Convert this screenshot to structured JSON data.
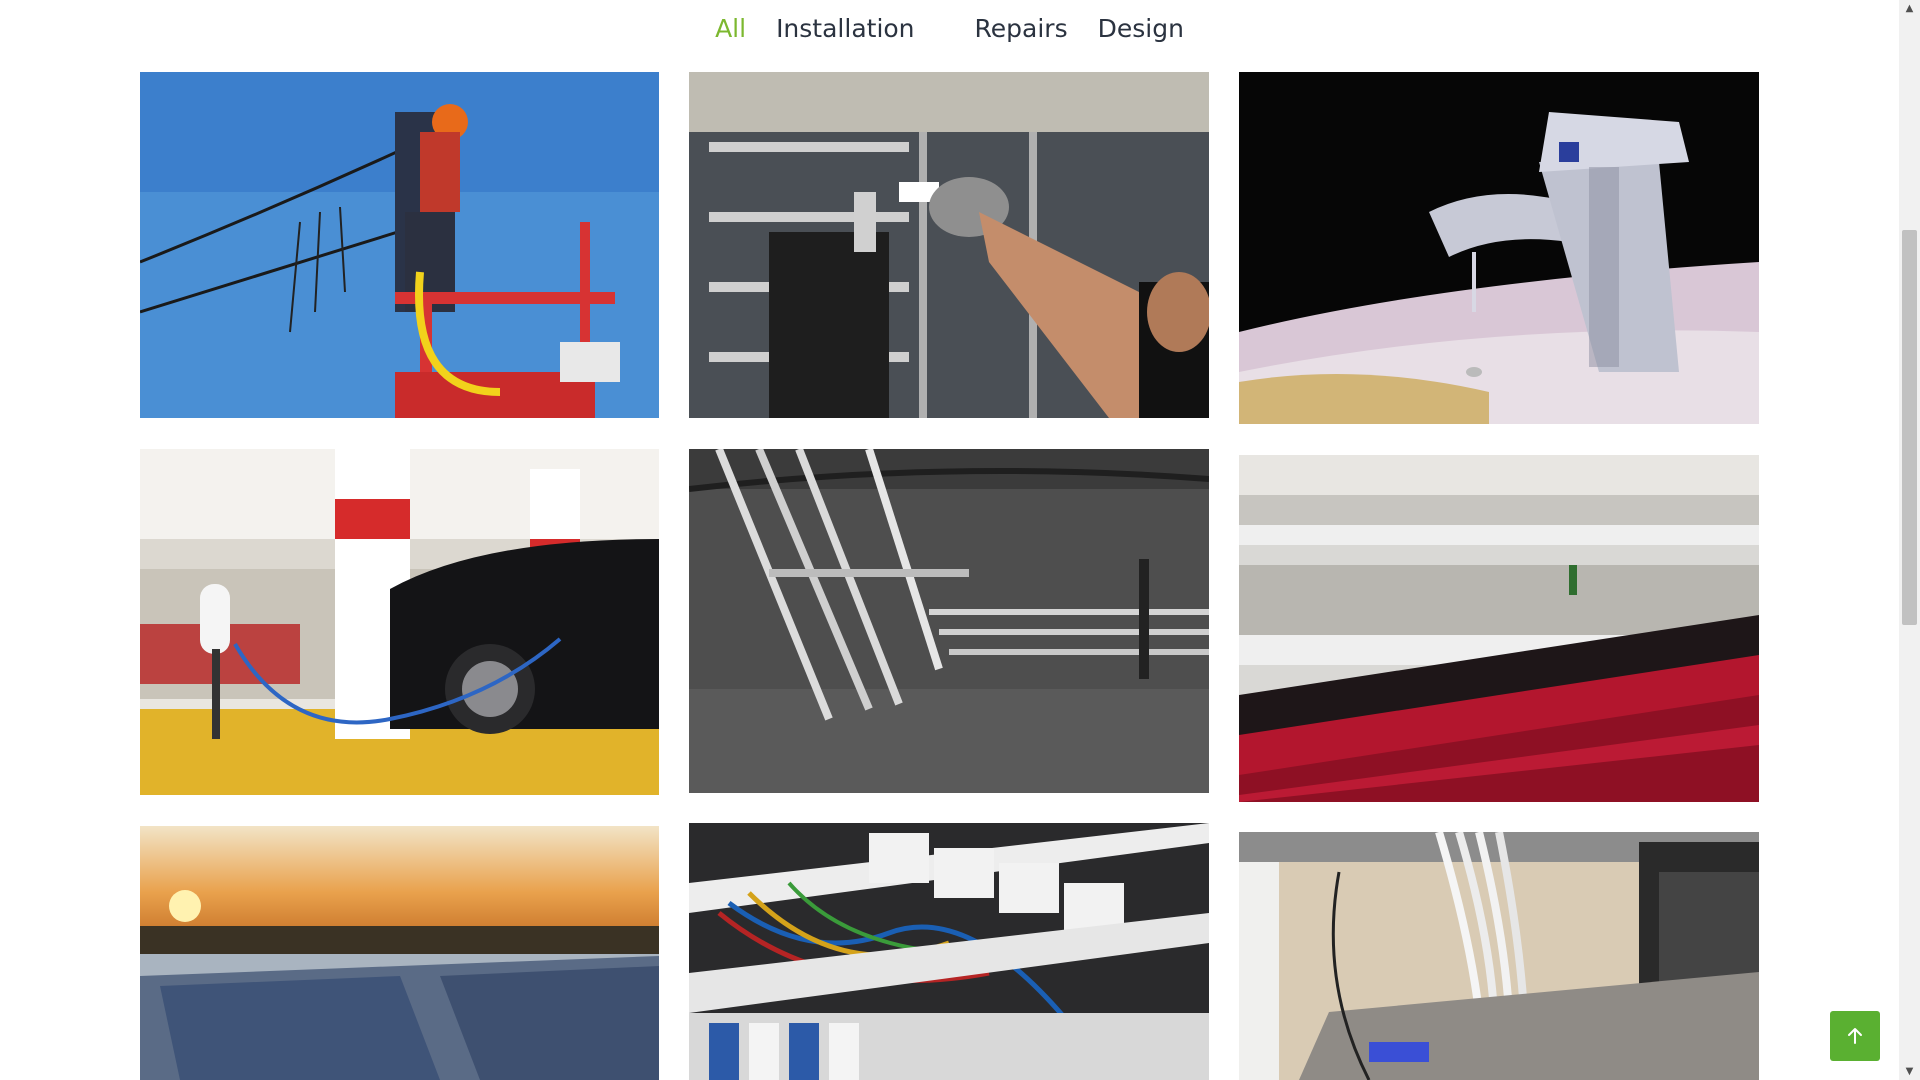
{
  "filters": [
    {
      "label": "All",
      "active": true
    },
    {
      "label": "Installation",
      "active": false
    },
    {
      "label": "Repairs",
      "active": false
    },
    {
      "label": "Design",
      "active": false
    }
  ],
  "gallery": {
    "items": [
      {
        "subject": "lineworker-on-bucket-lift"
      },
      {
        "subject": "technician-in-warehouse"
      },
      {
        "subject": "dripping-chrome-faucet"
      },
      {
        "subject": "electric-car-charging-in-garage"
      },
      {
        "subject": "overhead-metal-pipes"
      },
      {
        "subject": "network-patch-panel-red-cables"
      },
      {
        "subject": "solar-panels-at-sunset"
      },
      {
        "subject": "electrical-panel-wiring"
      },
      {
        "subject": "network-switch-white-cables"
      }
    ]
  },
  "back_to_top": {
    "icon": "arrow-up-icon",
    "color": "#5ab031"
  },
  "accent_color": "#7cb82f"
}
